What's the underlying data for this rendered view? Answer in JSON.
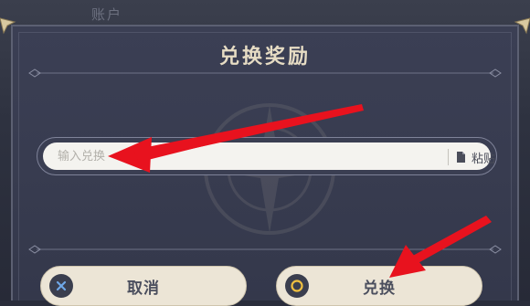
{
  "background": {
    "account_label": "账户"
  },
  "dialog": {
    "title": "兑换奖励",
    "code_input": {
      "value": "",
      "placeholder": "输入兑换"
    },
    "paste_label": "粘贴",
    "cancel_label": "取消",
    "confirm_label": "兑换"
  },
  "icons": {
    "paste": "clipboard-icon",
    "cancel": "cross-button-icon",
    "confirm": "circle-button-icon"
  },
  "colors": {
    "annotation_arrow": "#e8121e",
    "dialog_bg": "#383c50",
    "title_text": "#e6dcc4",
    "button_bg": "#ece5d6"
  }
}
